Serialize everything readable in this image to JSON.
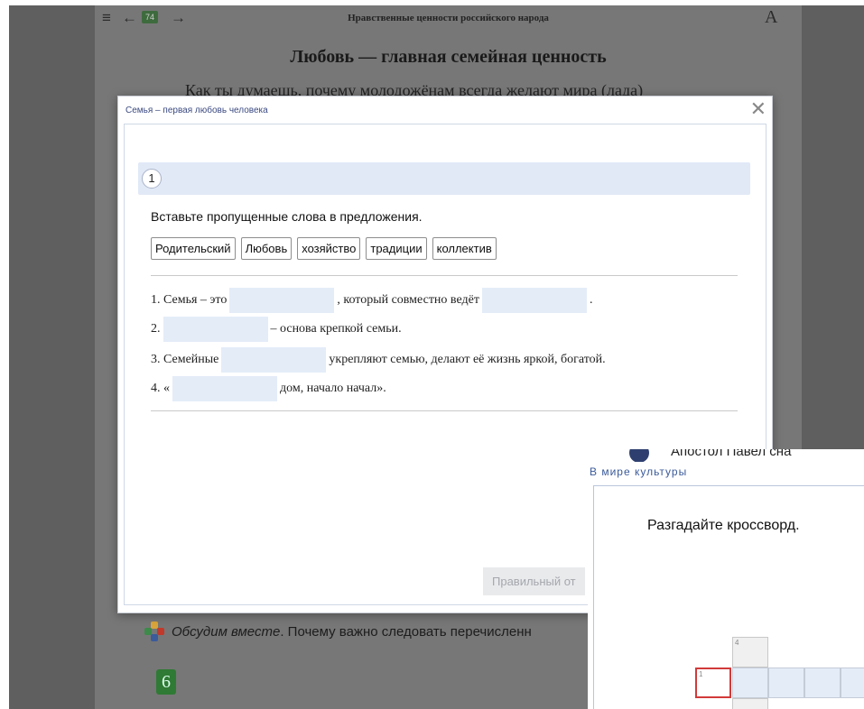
{
  "book": {
    "page_number": "74",
    "header_title": "Нравственные ценности российского народа",
    "chapter_title": "Любовь — главная семейная ценность",
    "intro_text": "Как ты думаешь, почему молодожёнам всегда желают мира (лада)",
    "discuss_label": "Обсудим вместе",
    "discuss_text": ". Почему важно следовать перечисленн",
    "badge": "6"
  },
  "dialog": {
    "title": "Семья – первая любовь человека",
    "close_symbol": "✕",
    "task_number": "1",
    "instruction": "Вставьте пропущенные слова в предложения.",
    "word_bank": [
      "Родительский",
      "Любовь",
      "хозяйство",
      "традиции",
      "коллектив"
    ],
    "sentences": {
      "s1_a": "1. Семья – это",
      "s1_b": ", который совместно ведёт",
      "s1_c": ".",
      "s2_a": "2.",
      "s2_b": "– основа крепкой семьи.",
      "s3_a": "3. Семейные",
      "s3_b": "укрепляют семью, делают её жизнь яркой, богатой.",
      "s4_a": "4. «",
      "s4_b": "дом, начало начал»."
    },
    "answer_button": "Правильный от"
  },
  "crossword": {
    "top_text": "Апостол Павел сна",
    "header": "В мире культуры",
    "instruction": "Разгадайте кроссворд.",
    "cell_numbers": [
      "4",
      "1"
    ]
  },
  "icons": [
    "menu-icon",
    "back-arrow-icon",
    "forward-arrow-icon",
    "font-size-icon",
    "close-icon",
    "discussion-icon"
  ]
}
